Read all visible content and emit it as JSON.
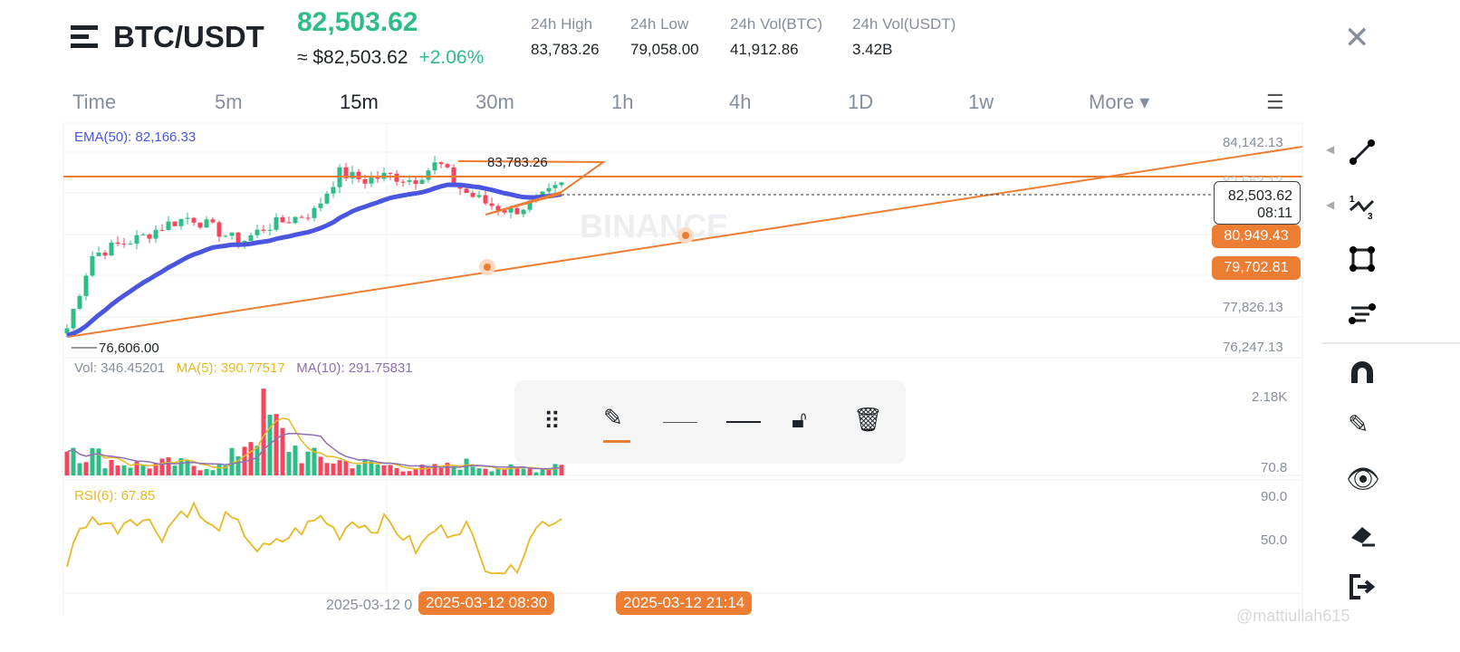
{
  "header": {
    "pair": "BTC/USDT",
    "price": "82,503.62",
    "approx": "≈ $82,503.62",
    "change": "+2.06%",
    "stats": [
      {
        "label": "24h High",
        "value": "83,783.26"
      },
      {
        "label": "24h Low",
        "value": "79,058.00"
      },
      {
        "label": "24h Vol(BTC)",
        "value": "41,912.86"
      },
      {
        "label": "24h Vol(USDT)",
        "value": "3.42B"
      }
    ]
  },
  "tabs": [
    "Time",
    "5m",
    "15m",
    "30m",
    "1h",
    "4h",
    "1D",
    "1w",
    "More"
  ],
  "active_tab": "15m",
  "indicators": {
    "ema": "EMA(50): 82,166.33",
    "vol": "Vol: 346.45201",
    "ma5": "MA(5): 390.77517",
    "ma10": "MA(10): 291.75831",
    "rsi": "RSI(6): 67.85"
  },
  "price_axis": [
    "84,142.13",
    "82,563.13",
    "77,826.13",
    "76,247.13"
  ],
  "current": {
    "price": "82,503.62",
    "countdown": "08:11"
  },
  "tags": [
    "80,949.43",
    "79,702.81"
  ],
  "annotations": {
    "high": "83,783.26",
    "low": "76,606.00"
  },
  "vol_axis": [
    "2.18K",
    "70.8"
  ],
  "rsi_axis": [
    "90.0",
    "50.0"
  ],
  "dates": {
    "axis": "2025-03-12 0",
    "sel1": "2025-03-12 08:30",
    "sel2": "2025-03-12 21:14"
  },
  "watermark": "BINANCE",
  "user": "@mattiullah615",
  "colors": {
    "up": "#2ebd85",
    "down": "#f6465d",
    "ema": "#4a55e0",
    "drawing": "#ec7d33",
    "rsi": "#e8b923"
  },
  "price_path": [
    77000,
    79800,
    80200,
    80500,
    81000,
    81300,
    80800,
    80300,
    80900,
    81200,
    81500,
    83000,
    82700,
    82900,
    82700,
    83400,
    82300,
    81800,
    81500,
    81900,
    82500
  ],
  "volume_path": [
    900,
    600,
    400,
    300,
    250,
    300,
    280,
    250,
    220,
    900,
    1500,
    900,
    500,
    400,
    350,
    300,
    250,
    200,
    180,
    200,
    300,
    250,
    200,
    150,
    180,
    350
  ],
  "rsi_path": [
    30,
    65,
    70,
    60,
    72,
    68,
    55,
    75,
    80,
    58,
    70,
    60,
    40,
    45,
    55,
    62,
    72,
    55,
    70,
    60,
    68,
    55,
    40,
    60,
    58,
    65,
    30,
    25,
    20,
    55,
    68,
    70
  ]
}
